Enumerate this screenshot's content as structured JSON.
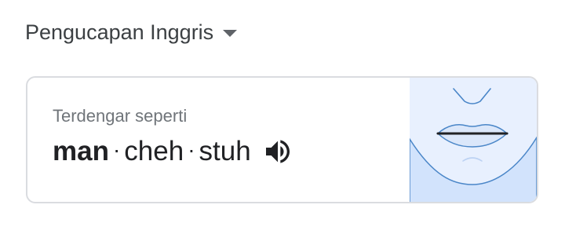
{
  "dropdown": {
    "label": "Pengucapan Inggris",
    "icon": "chevron-down-icon"
  },
  "card": {
    "sounds_like": "Terdengar seperti",
    "syllables": [
      {
        "text": "man",
        "stressed": true
      },
      {
        "text": "cheh",
        "stressed": false
      },
      {
        "text": "stuh",
        "stressed": false
      }
    ],
    "separator": "·",
    "speaker_icon": "speaker-icon",
    "mouth_illustration": "mouth-illustration"
  },
  "colors": {
    "text_primary": "#202124",
    "text_secondary": "#70757a",
    "border": "#dadce0",
    "panel_bg": "#e8f0fe",
    "face_fill": "#d2e3fc",
    "line_blue": "#4a86c8"
  }
}
